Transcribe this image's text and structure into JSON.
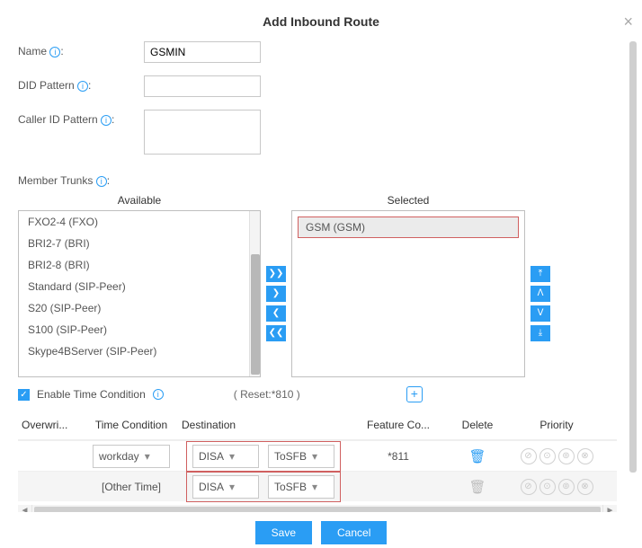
{
  "title": "Add Inbound Route",
  "fields": {
    "name_label": "Name",
    "name_value": "GSMIN",
    "did_label": "DID Pattern",
    "did_value": "",
    "cid_label": "Caller ID Pattern",
    "cid_value": ""
  },
  "member_trunks": {
    "label": "Member Trunks",
    "available_header": "Available",
    "selected_header": "Selected",
    "available": [
      "FXO2-4 (FXO)",
      "BRI2-7 (BRI)",
      "BRI2-8 (BRI)",
      "Standard (SIP-Peer)",
      "S20 (SIP-Peer)",
      "S100 (SIP-Peer)",
      "Skype4BServer (SIP-Peer)"
    ],
    "selected": [
      "GSM (GSM)"
    ]
  },
  "time_condition": {
    "enable_label": "Enable Time Condition",
    "enabled": true,
    "reset_label": "( Reset:*810 )"
  },
  "table": {
    "headers": {
      "overwrite": "Overwri...",
      "time_condition": "Time Condition",
      "destination": "Destination",
      "feature_code": "Feature Co...",
      "delete": "Delete",
      "priority": "Priority"
    },
    "rows": [
      {
        "time_condition": "workday",
        "dest_type": "DISA",
        "dest_target": "ToSFB",
        "feature_code": "*811",
        "other": false
      },
      {
        "time_condition": "[Other Time]",
        "dest_type": "DISA",
        "dest_target": "ToSFB",
        "feature_code": "",
        "other": true
      }
    ]
  },
  "buttons": {
    "save": "Save",
    "cancel": "Cancel"
  },
  "icons": {
    "move_all_right": "❯❯",
    "move_right": "❯",
    "move_left": "❮",
    "move_all_left": "❮❮",
    "move_top": "⤒",
    "move_up": "ᐱ",
    "move_down": "ᐯ",
    "move_bottom": "⤓",
    "caret": "▾",
    "check": "✓",
    "trash": "🗑",
    "left_arrow": "◄",
    "right_arrow": "►",
    "pri_top": "⊘",
    "pri_up": "⊙",
    "pri_down": "⊚",
    "pri_bottom": "⊗"
  }
}
